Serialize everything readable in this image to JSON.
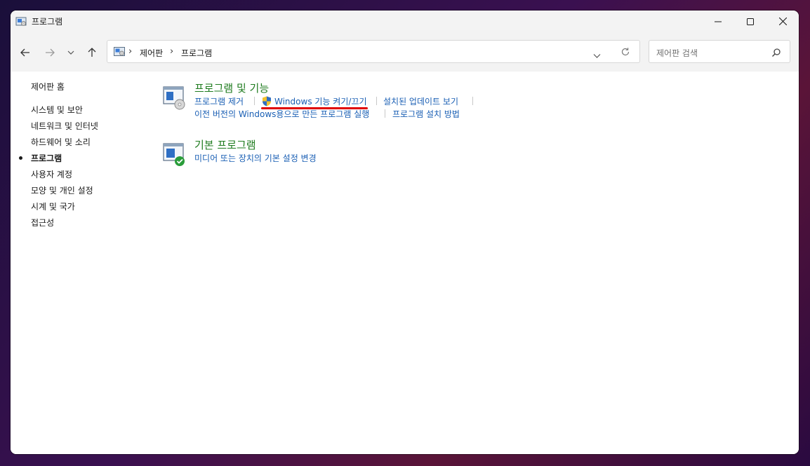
{
  "window": {
    "title": "프로그램",
    "minimize_icon": "minimize-icon",
    "maximize_icon": "maximize-icon",
    "close_icon": "close-icon"
  },
  "address": {
    "breadcrumb": [
      "제어판",
      "프로그램"
    ],
    "search_placeholder": "제어판 검색"
  },
  "sidebar": {
    "items": [
      {
        "label": "제어판 홈",
        "active": false
      },
      {
        "label": "시스템 및 보안",
        "active": false
      },
      {
        "label": "네트워크 및 인터넷",
        "active": false
      },
      {
        "label": "하드웨어 및 소리",
        "active": false
      },
      {
        "label": "프로그램",
        "active": true
      },
      {
        "label": "사용자 계정",
        "active": false
      },
      {
        "label": "모양 및 개인 설정",
        "active": false
      },
      {
        "label": "시계 및 국가",
        "active": false
      },
      {
        "label": "접근성",
        "active": false
      }
    ]
  },
  "categories": [
    {
      "title": "프로그램 및 기능",
      "links": [
        "프로그램 제거",
        "Windows 기능 켜기/끄기",
        "설치된 업데이트 보기",
        "이전 버전의 Windows용으로 만든 프로그램 실행",
        "프로그램 설치 방법"
      ]
    },
    {
      "title": "기본 프로그램",
      "links": [
        "미디어 또는 장치의 기본 설정 변경"
      ]
    }
  ],
  "colors": {
    "category_title": "#1e7b1e",
    "link": "#1a5fb4",
    "highlight_underline": "#e00000"
  }
}
